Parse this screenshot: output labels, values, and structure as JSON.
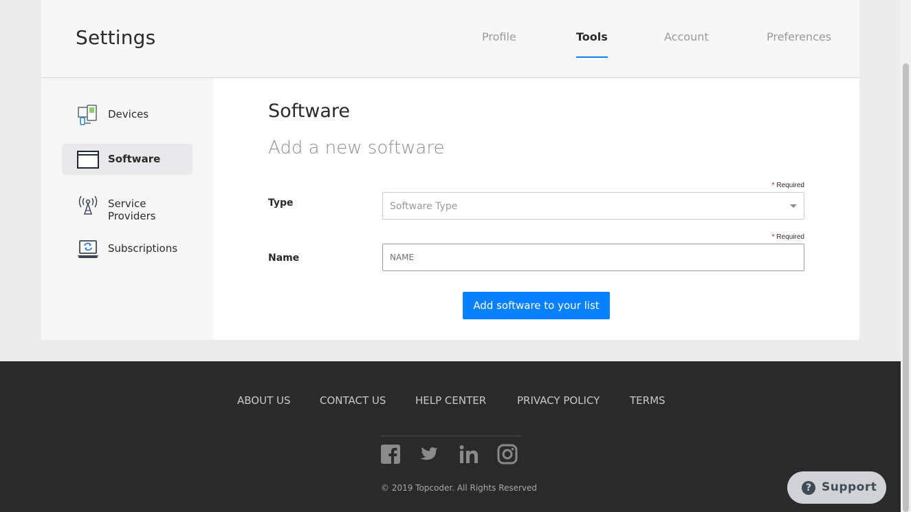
{
  "header": {
    "title": "Settings",
    "tabs": [
      {
        "label": "Profile",
        "active": false
      },
      {
        "label": "Tools",
        "active": true
      },
      {
        "label": "Account",
        "active": false
      },
      {
        "label": "Preferences",
        "active": false
      }
    ]
  },
  "sidebar": {
    "items": [
      {
        "label": "Devices",
        "icon": "devices-icon",
        "active": false
      },
      {
        "label": "Software",
        "icon": "software-window-icon",
        "active": true
      },
      {
        "label": "Service Providers",
        "icon": "antenna-icon",
        "active": false
      },
      {
        "label": "Subscriptions",
        "icon": "laptop-sync-icon",
        "active": false
      }
    ]
  },
  "main": {
    "title": "Software",
    "subtitle": "Add a new software",
    "required_star": "*",
    "required_text": "Required",
    "type_label": "Type",
    "type_placeholder": "Software Type",
    "name_label": "Name",
    "name_placeholder": "NAME",
    "submit_label": "Add software to your list"
  },
  "footer": {
    "links": [
      "ABOUT US",
      "CONTACT US",
      "HELP CENTER",
      "PRIVACY POLICY",
      "TERMS"
    ],
    "social": [
      "facebook-icon",
      "twitter-icon",
      "linkedin-icon",
      "instagram-icon"
    ],
    "copyright": "© 2019 Topcoder. All Rights Reserved"
  },
  "support": {
    "label": "Support",
    "icon_glyph": "?"
  },
  "colors": {
    "accent": "#0681ff",
    "footer_bg": "#2a2a2a",
    "required": "#ef0a0a"
  }
}
